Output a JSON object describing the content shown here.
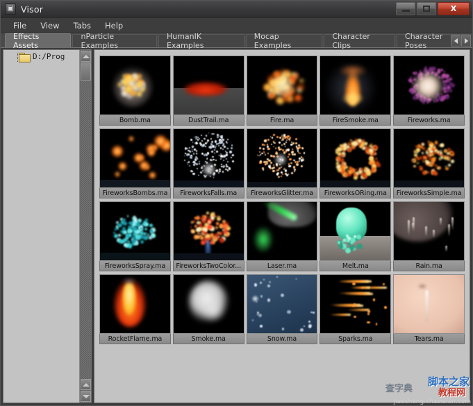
{
  "window": {
    "title": "Visor",
    "app_icon": "maya-visor-icon",
    "buttons": {
      "minimize": "minimize-button",
      "maximize": "maximize-button",
      "close": "X"
    }
  },
  "menubar": {
    "items": [
      {
        "label": "File"
      },
      {
        "label": "View"
      },
      {
        "label": "Tabs"
      },
      {
        "label": "Help"
      }
    ]
  },
  "tabs": {
    "items": [
      {
        "label": "Effects Assets",
        "active": true
      },
      {
        "label": "nParticle Examples",
        "active": false
      },
      {
        "label": "HumanIK Examples",
        "active": false
      },
      {
        "label": "Mocap Examples",
        "active": false
      },
      {
        "label": "Character Clips",
        "active": false
      },
      {
        "label": "Character Poses",
        "active": false
      }
    ],
    "scroll_left": "scroll-tabs-left",
    "scroll_right": "scroll-tabs-right"
  },
  "sidebar": {
    "tree": [
      {
        "label": "D:/Prog",
        "icon": "folder-icon"
      }
    ],
    "scrollbar": {
      "up": "scroll-up",
      "down": "scroll-down"
    }
  },
  "grid": {
    "columns": 5,
    "items": [
      {
        "label": "Bomb.ma",
        "art": "bomb"
      },
      {
        "label": "DustTrail.ma",
        "art": "dusttrail"
      },
      {
        "label": "Fire.ma",
        "art": "fire"
      },
      {
        "label": "FireSmoke.ma",
        "art": "firesmoke"
      },
      {
        "label": "Fireworks.ma",
        "art": "fireworks"
      },
      {
        "label": "FireworksBombs.ma",
        "art": "fireworksbombs"
      },
      {
        "label": "FireworksFalls.ma",
        "art": "fireworksfalls"
      },
      {
        "label": "FireworksGlitter.ma",
        "art": "fireworksglitter"
      },
      {
        "label": "FireworksORing.ma",
        "art": "fireworksoring"
      },
      {
        "label": "FireworksSimple.ma",
        "art": "fireworkssimple"
      },
      {
        "label": "FireworksSpray.ma",
        "art": "fireworksspray"
      },
      {
        "label": "FireworksTwoColor...",
        "art": "fireworkstwocolor"
      },
      {
        "label": "Laser.ma",
        "art": "laser"
      },
      {
        "label": "Melt.ma",
        "art": "melt"
      },
      {
        "label": "Rain.ma",
        "art": "rain"
      },
      {
        "label": "RocketFlame.ma",
        "art": "rocketflame"
      },
      {
        "label": "Smoke.ma",
        "art": "smoke"
      },
      {
        "label": "Snow.ma",
        "art": "snow"
      },
      {
        "label": "Sparks.ma",
        "art": "sparks"
      },
      {
        "label": "Tears.ma",
        "art": "tears"
      }
    ]
  },
  "watermarks": {
    "cn_left": "查字典",
    "cn_top": "脚本之家",
    "cn_bottom": "教程网",
    "en": "jiaocheng.chazidian.com"
  },
  "colors": {
    "window_bg": "#3c3c3c",
    "panel_bg": "#c3c3c3",
    "tab_active": "#6b6b6b",
    "close_button": "#c0432f",
    "thumb_bg": "#000000"
  }
}
